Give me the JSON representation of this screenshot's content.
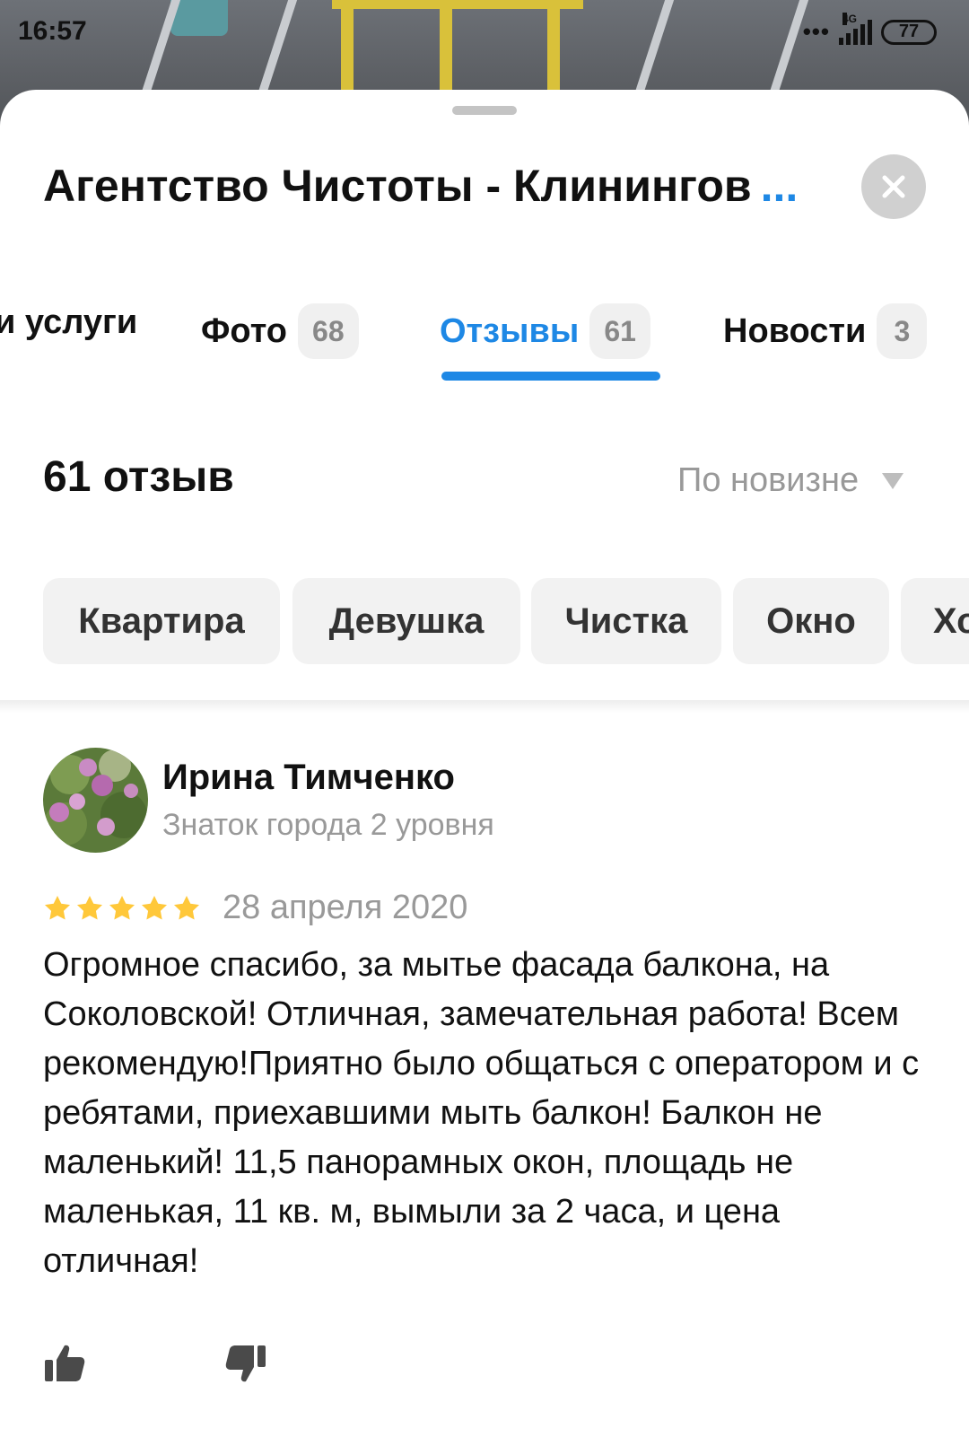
{
  "status_bar": {
    "time": "16:57",
    "network": "4G",
    "battery": "77",
    "icons": [
      "more-dots-icon",
      "signal-icon",
      "battery-icon"
    ]
  },
  "header": {
    "title": "Агентство Чистоты - Клинингов",
    "title_more": "...",
    "close_icon": "close-icon"
  },
  "tabs": [
    {
      "label": "и услуги",
      "count": null
    },
    {
      "label": "Фото",
      "count": "68"
    },
    {
      "label": "Отзывы",
      "count": "61",
      "active": true
    },
    {
      "label": "Новости",
      "count": "3"
    }
  ],
  "reviews": {
    "count_label": "61 отзыв",
    "sort_label": "По новизне"
  },
  "chips": [
    "Квартира",
    "Девушка",
    "Чистка",
    "Окно",
    "Хо"
  ],
  "review": {
    "author": "Ирина Тимченко",
    "level": "Знаток города 2 уровня",
    "rating": 5,
    "date": "28 апреля 2020",
    "text": "Огромное спасибо, за мытье фасада балкона, на Соколовской! Отличная, замечательная работа! Всем рекомендую!Приятно было общаться с оператором и с ребятами, приехавшими мыть балкон! Балкон не маленький! 11,5 панорамных окон, площадь не маленькая, 11 кв. м, вымыли за 2 часа, и цена отличная!"
  },
  "colors": {
    "accent": "#1e88e5",
    "star": "#ffc83a",
    "muted": "#999999"
  }
}
